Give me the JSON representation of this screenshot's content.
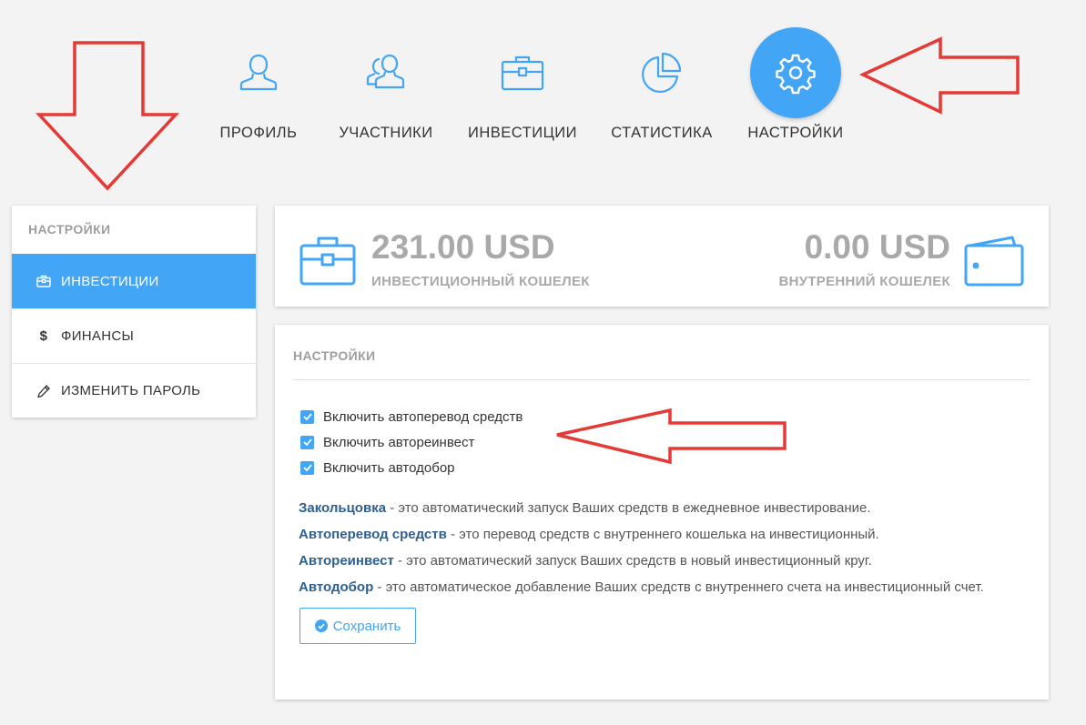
{
  "nav": {
    "items": [
      {
        "label": "ПРОФИЛЬ",
        "icon": "user-icon"
      },
      {
        "label": "УЧАСТНИКИ",
        "icon": "users-icon"
      },
      {
        "label": "ИНВЕСТИЦИИ",
        "icon": "briefcase-icon"
      },
      {
        "label": "СТАТИСТИКА",
        "icon": "pie-chart-icon"
      },
      {
        "label": "НАСТРОЙКИ",
        "icon": "gear-icon",
        "active": true
      }
    ]
  },
  "sidebar": {
    "title": "НАСТРОЙКИ",
    "items": [
      {
        "label": "ИНВЕСТИЦИИ",
        "icon": "briefcase-icon",
        "active": true
      },
      {
        "label": "ФИНАНСЫ",
        "icon": "dollar-icon"
      },
      {
        "label": "ИЗМЕНИТЬ ПАРОЛЬ",
        "icon": "pencil-icon"
      }
    ]
  },
  "balances": {
    "investment": {
      "amount": "231.00 USD",
      "label": "ИНВЕСТИЦИОННЫЙ КОШЕЛЕК"
    },
    "internal": {
      "amount": "0.00 USD",
      "label": "ВНУТРЕННИЙ КОШЕЛЕК"
    }
  },
  "settings": {
    "title": "НАСТРОЙКИ",
    "options": [
      {
        "label": "Включить автоперевод средств",
        "checked": true
      },
      {
        "label": "Включить автореинвест",
        "checked": true
      },
      {
        "label": "Включить автодобор",
        "checked": true
      }
    ],
    "definitions": [
      {
        "term": "Закольцовка",
        "text": " - это автоматический запуск Ваших средств в ежедневное инвестирование."
      },
      {
        "term": "Автоперевод средств",
        "text": " - это перевод средств с внутреннего кошелька на инвестиционный."
      },
      {
        "term": "Автореинвест",
        "text": " - это автоматический запуск Ваших средств в новый инвестиционный круг."
      },
      {
        "term": "Автодобор",
        "text": " - это автоматическое добавление Ваших средств с внутреннего счета на инвестиционный счет."
      }
    ],
    "save_label": "Сохранить"
  },
  "colors": {
    "accent": "#42a5f5",
    "annotation": "#e53935",
    "term": "#2f5f8f"
  }
}
